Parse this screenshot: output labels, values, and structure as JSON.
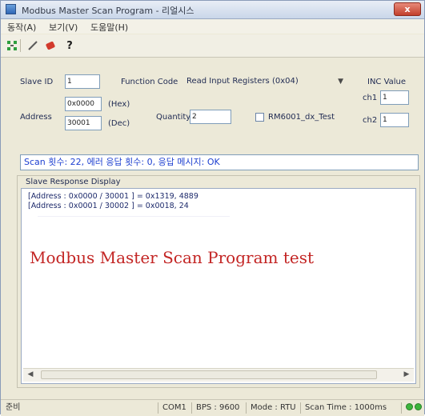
{
  "window": {
    "title": "Modbus Master Scan Program - 리얼시스",
    "close_label": "x"
  },
  "menu": [
    "동작(A)",
    "보기(V)",
    "도움말(H)"
  ],
  "toolbar": {
    "icons": [
      "connect-icon",
      "pencil-icon",
      "erase-icon",
      "help-icon"
    ]
  },
  "form": {
    "slave_id_label": "Slave ID",
    "slave_id_value": "1",
    "function_code_label": "Function Code",
    "function_code_value": "Read Input Registers (0x04)",
    "inc_value_label": "INC Value",
    "ch1_label": "ch1",
    "ch1_value": "1",
    "ch2_label": "ch2",
    "ch2_value": "1",
    "address_label": "Address",
    "address_hex_value": "0x0000",
    "hex_label": "(Hex)",
    "address_dec_value": "30001",
    "dec_label": "(Dec)",
    "quantity_label": "Quantity",
    "quantity_value": "2",
    "rm_checkbox_label": "RM6001_dx_Test"
  },
  "scan_status": "Scan 횟수: 22, 에러 응답 횟수: 0, 응답 메시지: OK",
  "response": {
    "title": "Slave Response Display",
    "lines": [
      "[Address : 0x0000 / 30001 ] = 0x1319, 4889",
      "[Address : 0x0001 / 30002 ] = 0x0018, 24"
    ],
    "overlay_caption": "Modbus Master Scan Program test"
  },
  "statusbar": {
    "left": "준비",
    "port": "COM1",
    "bps": "BPS : 9600",
    "mode": "Mode : RTU",
    "scan_time": "Scan Time : 1000ms"
  },
  "colors": {
    "status_text": "#1d3fd0",
    "overlay_text": "#c32524",
    "led": "#3cb53c"
  }
}
